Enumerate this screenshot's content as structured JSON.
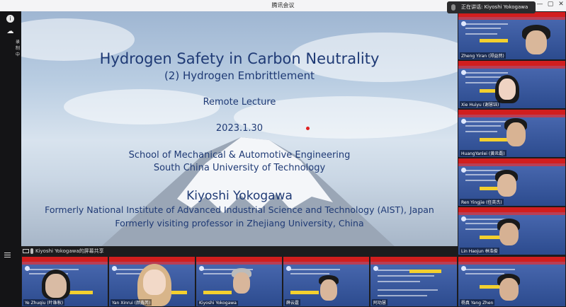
{
  "window": {
    "title": "腾讯会议",
    "controls": [
      "—",
      "▢",
      "✕"
    ]
  },
  "speaking_indicator": "正在讲话: Kiyoshi Yokogawa",
  "left_rail": {
    "status_label": "录制中"
  },
  "slide": {
    "title": "Hydrogen Safety in Carbon Neutrality",
    "subtitle": "(2) Hydrogen Embrittlement",
    "lecture_type": "Remote Lecture",
    "date": "2023.1.30",
    "school": "School of Mechanical & Automotive Engineering",
    "university": "South China University of Technology",
    "speaker": "Kiyoshi Yokogawa",
    "affiliation_1": "Formerly National Institute of Advanced Industrial Science and Technology (AIST), Japan",
    "affiliation_2": "Formerly visiting professor in Zhejiang University, China"
  },
  "share_bar": {
    "text": "Kiyoshi Yokogawa的屏幕共享"
  },
  "side_participants": [
    {
      "name": "Zheng Yiran (郑益然)"
    },
    {
      "name": "Xie Huiyu (谢慧钰)"
    },
    {
      "name": "HuangYanlei (黄炎磊)"
    },
    {
      "name": "Ren Yingjie (任英杰)"
    },
    {
      "name": "Lin Haojun 林浩俊"
    }
  ],
  "bottom_participants": [
    {
      "name": "Ye Zhuqiu (叶珠秋)"
    },
    {
      "name": "Yan Xinrui (颜鑫芮)"
    },
    {
      "name": "Kiyoshi Yokogawa"
    },
    {
      "name": "薛云霆"
    },
    {
      "name": "阿功慧"
    },
    {
      "name": "杨真 Yang Zhen"
    }
  ]
}
